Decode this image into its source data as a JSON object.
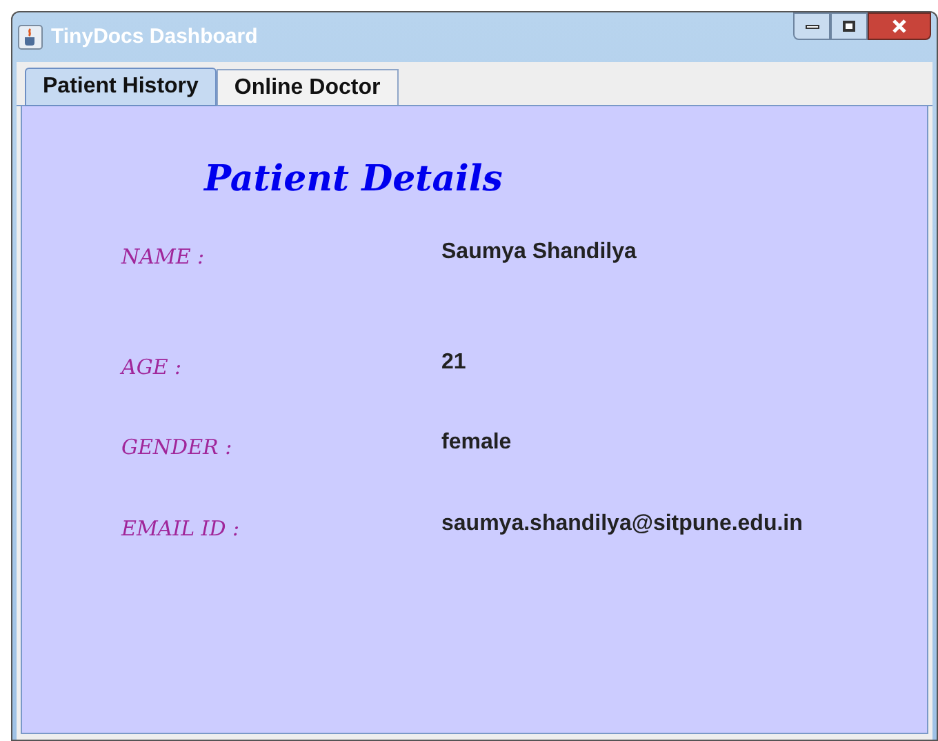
{
  "window": {
    "title": "TinyDocs Dashboard"
  },
  "tabs": [
    {
      "label": "Patient History",
      "selected": true
    },
    {
      "label": "Online Doctor",
      "selected": false
    }
  ],
  "panel": {
    "heading": "Patient Details",
    "fields": [
      {
        "label": "NAME :",
        "value": "Saumya Shandilya"
      },
      {
        "label": "AGE :",
        "value": "21"
      },
      {
        "label": "GENDER :",
        "value": "female"
      },
      {
        "label": "EMAIL ID :",
        "value": "saumya.shandilya@sitpune.edu.in"
      }
    ]
  }
}
